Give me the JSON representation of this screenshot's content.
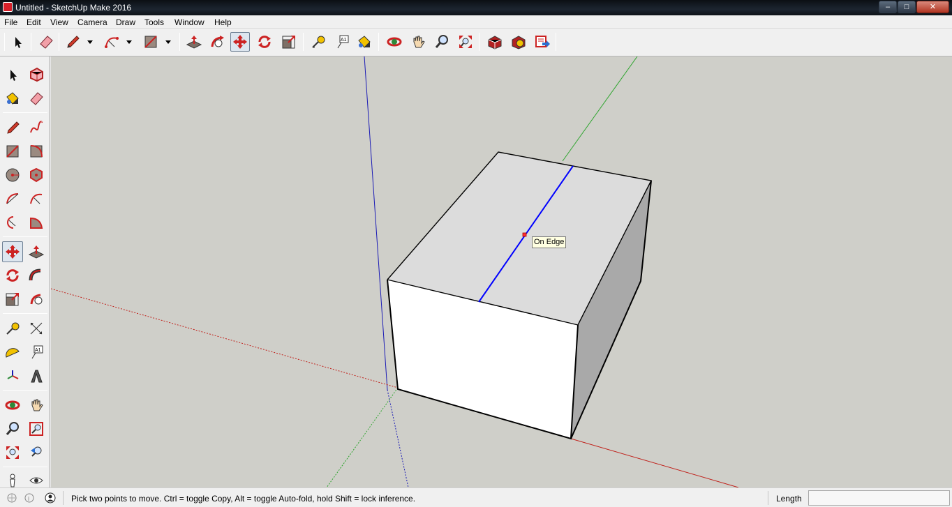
{
  "window": {
    "title": "Untitled - SketchUp Make 2016",
    "minimize_glyph": "–",
    "maximize_glyph": "□",
    "close_glyph": "✕"
  },
  "menu": [
    "File",
    "Edit",
    "View",
    "Camera",
    "Draw",
    "Tools",
    "Window",
    "Help"
  ],
  "toolbar_top": {
    "tools": [
      "select-icon",
      "eraser-icon",
      "pencil-icon",
      "arc-icon",
      "rectangle-icon",
      "push-pull-icon",
      "follow-me-icon",
      "move-icon",
      "rotate-icon",
      "scale-icon",
      "tape-measure-icon",
      "text-icon",
      "paint-bucket-icon",
      "orbit-icon",
      "pan-icon",
      "zoom-icon",
      "zoom-extents-icon",
      "3d-warehouse-icon",
      "extension-warehouse-icon",
      "layout-send-icon"
    ],
    "active_tool": "move-icon"
  },
  "toolbar_left": {
    "active_tool": "move-icon",
    "text_tool_label": "A1"
  },
  "viewport": {
    "inference_tooltip": "On Edge",
    "colors": {
      "background": "#cfcfc9",
      "red_axis": "#c0201a",
      "green_axis": "#2fa52f",
      "blue_axis": "#1a1ab5",
      "top_face": "#dcdcdc",
      "front_face": "#ffffff",
      "side_face": "#a9a9a9",
      "inference_edge": "#0000ff"
    }
  },
  "statusbar": {
    "message": "Pick two points to move.  Ctrl = toggle Copy, Alt = toggle Auto-fold, hold Shift = lock inference.",
    "vcb_label": "Length",
    "vcb_value": ""
  }
}
